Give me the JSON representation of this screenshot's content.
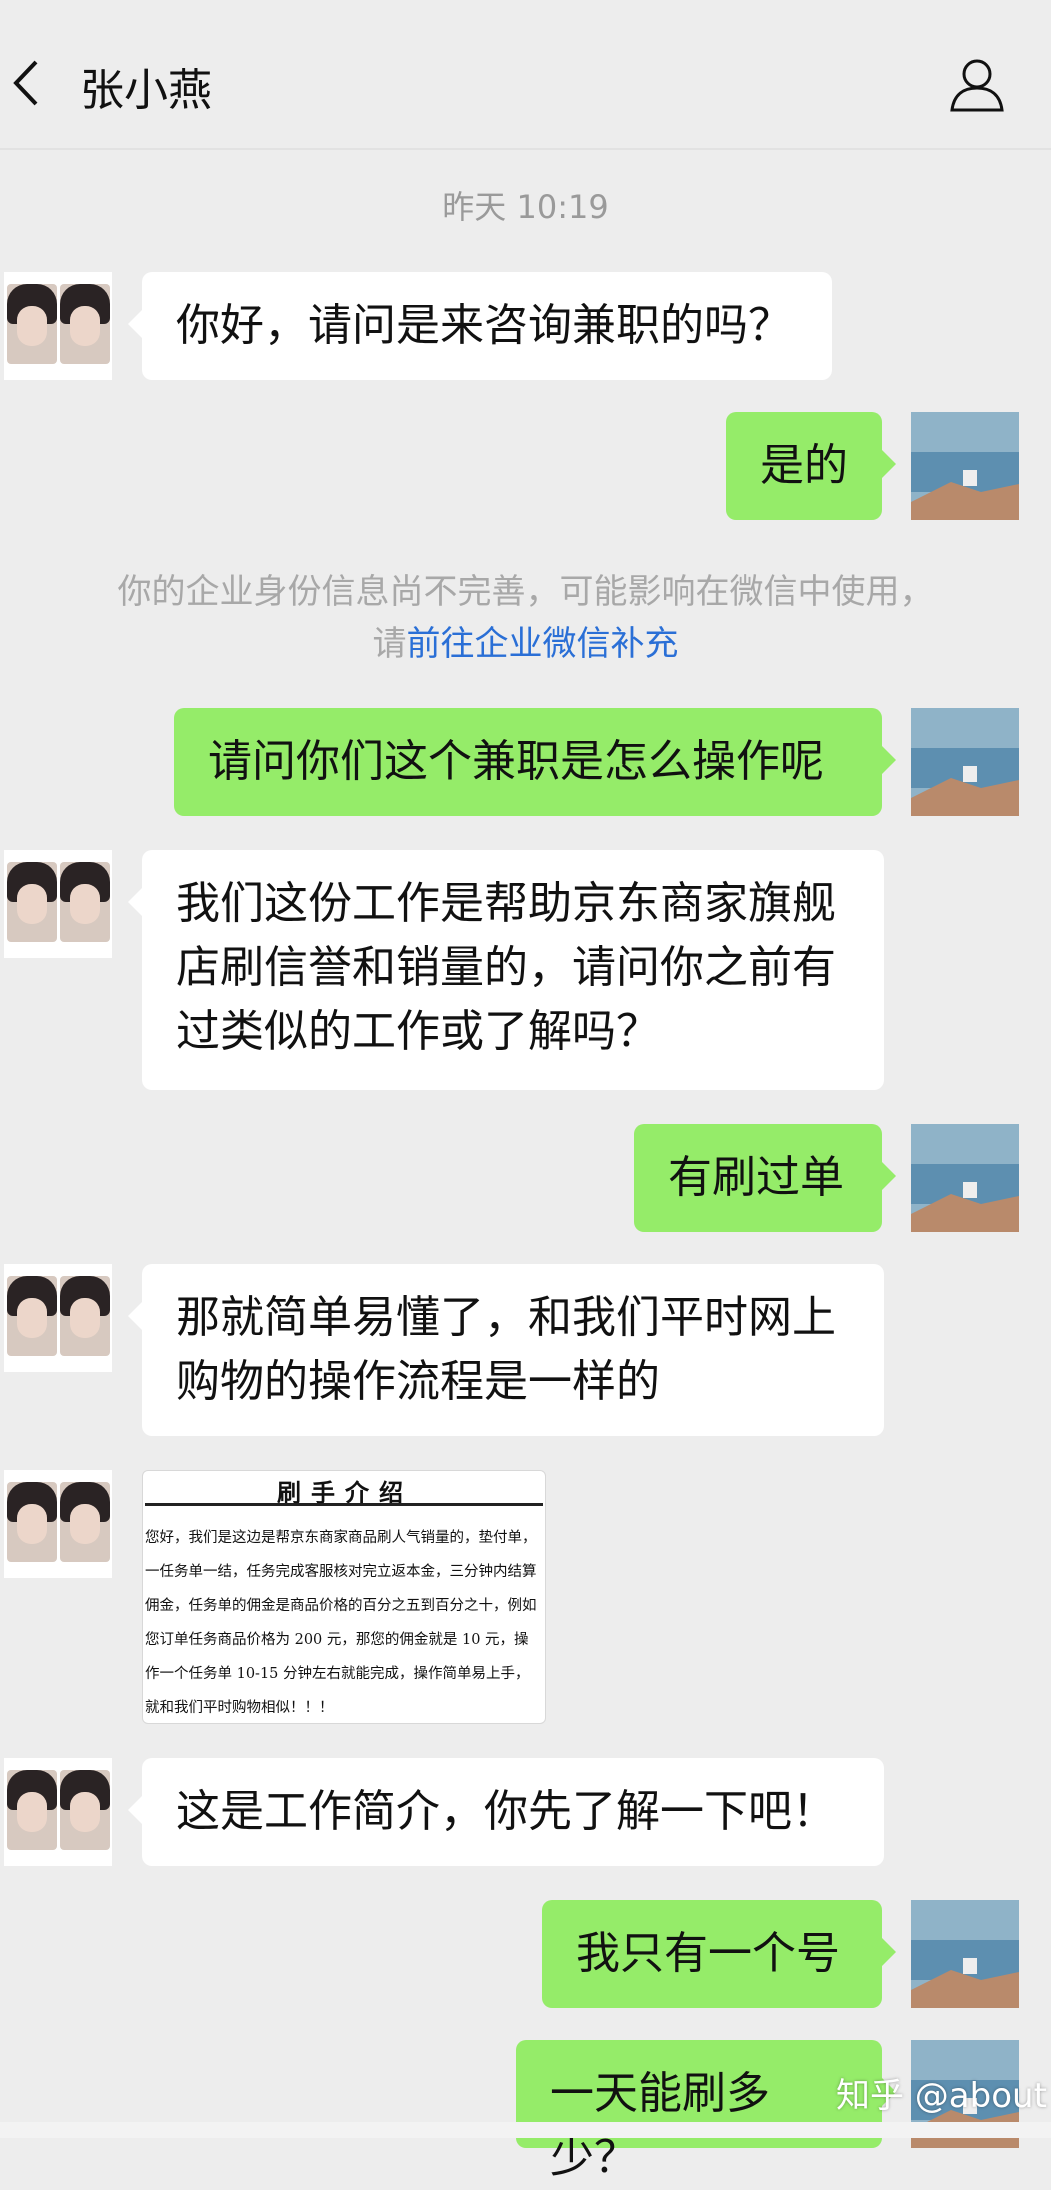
{
  "header": {
    "contact_name": "张小燕"
  },
  "timestamp": "昨天 10:19",
  "notice": {
    "line1": "你的企业身份信息尚不完善，可能影响在微信中使用，",
    "prefix": "请",
    "link": "前往企业微信补充"
  },
  "messages": [
    {
      "side": "left",
      "text": "你好，请问是来咨询兼职的吗？"
    },
    {
      "side": "right",
      "text": "是的"
    },
    {
      "side": "right",
      "text": "请问你们这个兼职是怎么操作呢"
    },
    {
      "side": "left",
      "text": "我们这份工作是帮助京东商家旗舰店刷信誉和销量的，请问你之前有过类似的工作或了解吗？"
    },
    {
      "side": "right",
      "text": "有刷过单"
    },
    {
      "side": "left",
      "text": "那就简单易懂了，和我们平时网上购物的操作流程是一样的"
    },
    {
      "side": "left",
      "text": "这是工作简介，你先了解一下吧！"
    },
    {
      "side": "right",
      "text": "我只有一个号"
    },
    {
      "side": "right",
      "text": "一天能刷多少？"
    }
  ],
  "card": {
    "title": "刷手介绍",
    "body": "您好，我们是这边是帮京东商家商品刷人气销量的，垫付单，一任务单一结，任务完成客服核对完立返本金，三分钟内结算佣金，任务单的佣金是商品价格的百分之五到百分之十，例如您订单任务商品价格为 200 元，那您的佣金就是 10 元，操作一个任务单 10-15 分钟左右就能完成，操作简单易上手，就和我们平时购物相似！！！"
  },
  "watermark": "知乎 @about",
  "colors": {
    "background": "#ededed",
    "sent_bubble": "#95ec69",
    "received_bubble": "#ffffff",
    "link": "#2a6fd6"
  },
  "icons": [
    "back-arrow-icon",
    "profile-icon"
  ]
}
